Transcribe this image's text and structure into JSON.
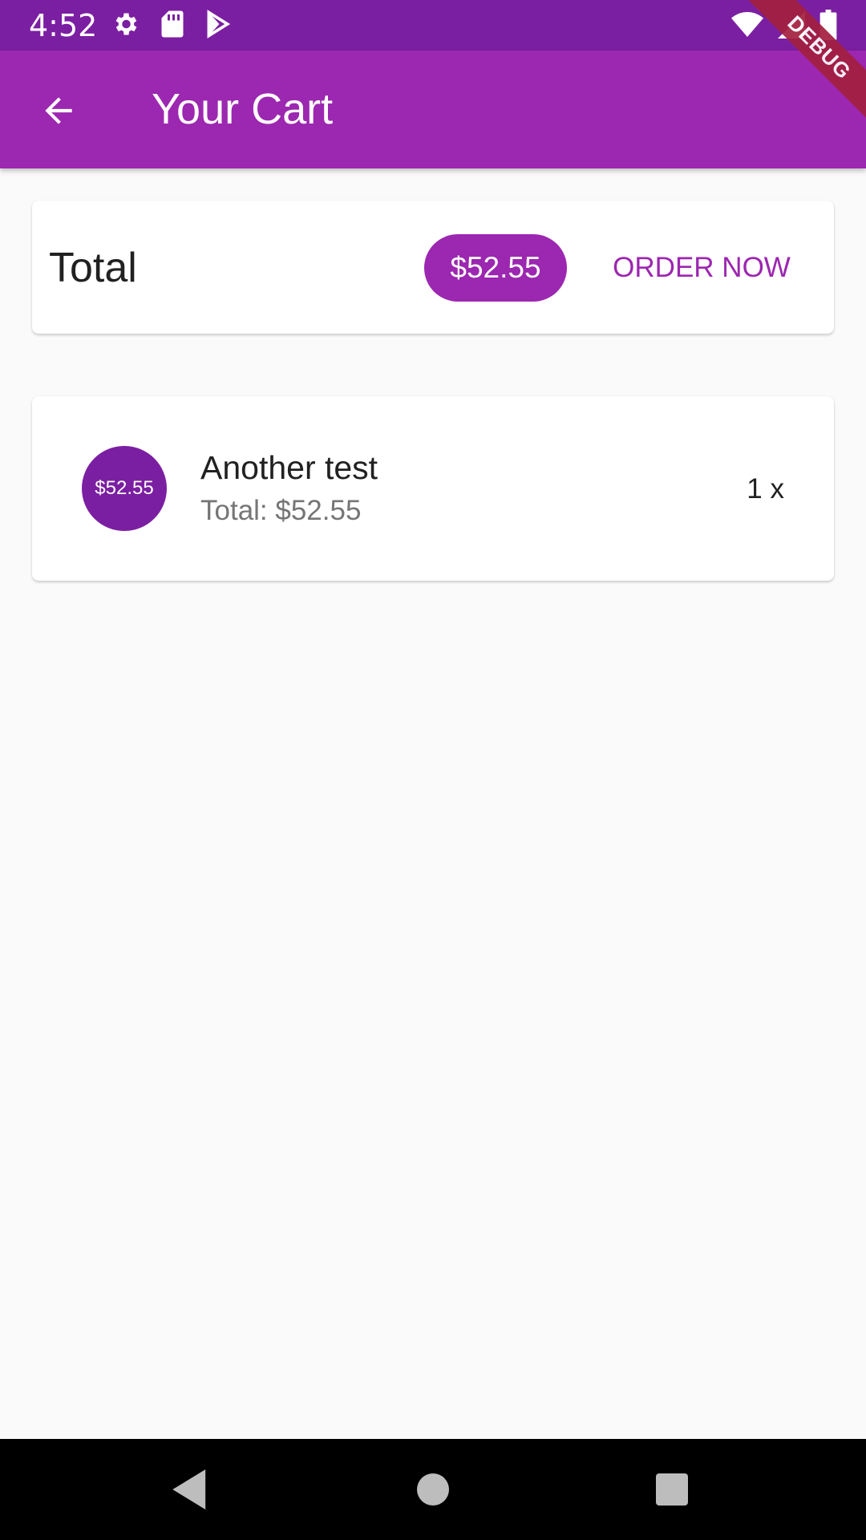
{
  "status_bar": {
    "time": "4:52",
    "icons_left": [
      "gear-icon",
      "sd-card-icon",
      "play-store-icon"
    ],
    "icons_right": [
      "wifi-icon",
      "signal-icon",
      "battery-icon"
    ],
    "background": "#7b1fa2"
  },
  "app_bar": {
    "title": "Your Cart",
    "back_icon": "arrow-back-icon",
    "background": "#9c27b0"
  },
  "debug_banner": {
    "label": "DEBUG",
    "color": "#a31f3f"
  },
  "summary": {
    "total_label": "Total",
    "total_amount": "$52.55",
    "order_button_label": "ORDER NOW",
    "accent": "#9c27b0"
  },
  "cart_items": [
    {
      "avatar_price": "$52.55",
      "title": "Another test",
      "subtitle": "Total: $52.55",
      "quantity": "1 x"
    }
  ],
  "nav_bar": {
    "buttons": [
      "back-triangle-icon",
      "home-circle-icon",
      "recents-square-icon"
    ]
  }
}
